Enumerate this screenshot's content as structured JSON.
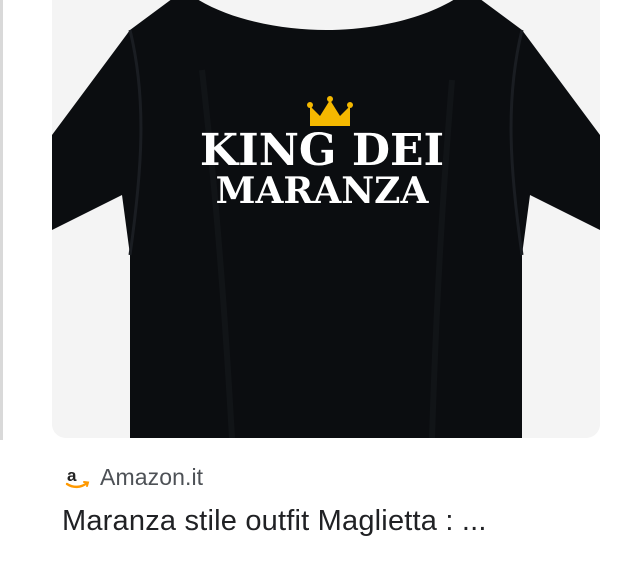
{
  "result": {
    "source": "Amazon.it",
    "title": "Maranza stile outfit Maglietta : ..."
  },
  "image": {
    "subject": "t-shirt",
    "print_line1": "KING DEI",
    "print_line2": "MARANZA",
    "shirt_color": "#0b0d10",
    "print_color": "#ffffff",
    "crown_color": "#f5b800"
  },
  "favicon": {
    "icon": "amazon-logo-icon",
    "color": "#222222",
    "accent": "#ff9900"
  }
}
